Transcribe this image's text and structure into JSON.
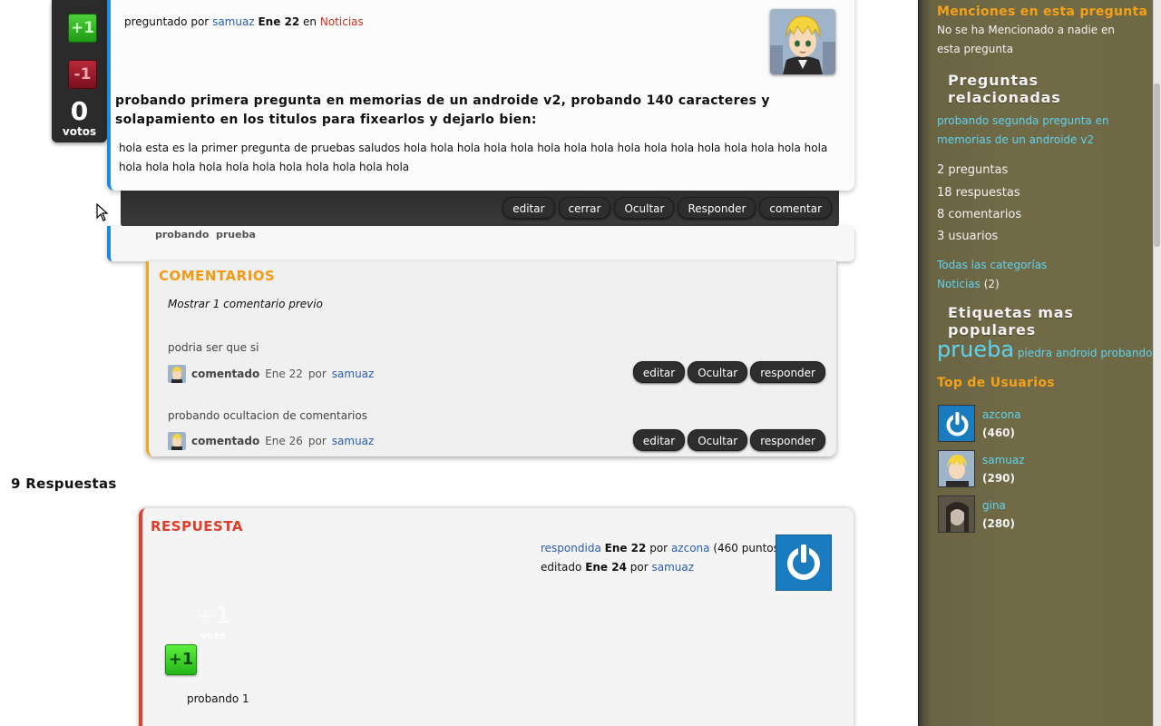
{
  "question": {
    "vote": {
      "up": "+1",
      "down": "-1",
      "count": "0",
      "label": "votos"
    },
    "meta": {
      "prefix": "preguntado por",
      "author": "samuaz",
      "date": "Ene 22",
      "in": "en",
      "category": "Noticias"
    },
    "title": "probando primera pregunta en memorias de un androide v2, probando 140 caracteres y solapamiento en los titulos para fixearlos y dejarlo bien:",
    "body": "hola esta es la primer pregunta de pruebas saludos hola hola hola hola hola hola hola hola hola hola hola hola hola hola hola hola hola hola hola hola hola hola hola hola hola hola hola",
    "actions": [
      "editar",
      "cerrar",
      "Ocultar",
      "Responder",
      "comentar"
    ],
    "tags": [
      "probando",
      "prueba"
    ]
  },
  "comments": {
    "title": "COMENTARIOS",
    "show_previous": "Mostrar 1 comentario previo",
    "items": [
      {
        "text": "podria ser que si",
        "label": "comentado",
        "date": "Ene 22",
        "by": "por",
        "author": "samuaz",
        "actions": [
          "editar",
          "Ocultar",
          "responder"
        ]
      },
      {
        "text": "probando ocultacion de comentarios",
        "label": "comentado",
        "date": "Ene 26",
        "by": "por",
        "author": "samuaz",
        "actions": [
          "editar",
          "Ocultar",
          "responder"
        ]
      }
    ]
  },
  "answers": {
    "count_label": "9 Respuestas",
    "first": {
      "title": "RESPUESTA",
      "answered_label": "respondida",
      "answered_date": "Ene 22",
      "by": "por",
      "author": "azcona",
      "points": "(460 puntos)",
      "edited_label": "editado",
      "edited_date": "Ene 24",
      "editor": "samuaz",
      "ghost_vote": "+1",
      "ghost_vote_label": "voto",
      "upvote": "+1",
      "body": "probando 1"
    }
  },
  "sidebar": {
    "mentions_title": "Menciones en esta pregunta",
    "mentions_text": "No se ha Mencionado a nadie en esta pregunta",
    "related_title": "Preguntas relacionadas",
    "related_link": "probando segunda pregunta en memorias de un androide v2",
    "stats": [
      "2 preguntas",
      "18 respuestas",
      "8 comentarios",
      "3 usuarios"
    ],
    "all_categories": "Todas las categorías",
    "category_link": "Noticias",
    "category_count": "(2)",
    "popular_tags_title": "Etiquetas mas populares",
    "popular_tags": {
      "big": "prueba",
      "small": [
        "piedra",
        "android",
        "probando"
      ]
    },
    "top_users_title": "Top de Usuarios",
    "top_users": [
      {
        "name": "azcona",
        "points": "(460)"
      },
      {
        "name": "samuaz",
        "points": "(290)"
      },
      {
        "name": "gina",
        "points": "(280)"
      }
    ]
  },
  "colors": {
    "accent_blue": "#1e88e5",
    "comments_orange": "#f4a51c",
    "answer_red": "#e04030",
    "sidebar_bg": "#716a47",
    "link_cyan": "#5fd3ef"
  }
}
